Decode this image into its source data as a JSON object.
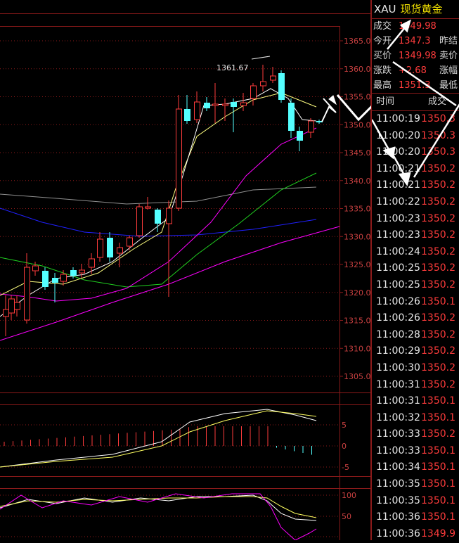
{
  "chart": {
    "price_axis": [
      "1365.0",
      "1360.0",
      "1355.0",
      "1350.0",
      "1345.0",
      "1340.0",
      "1335.0",
      "1330.0",
      "1325.0",
      "1320.0",
      "1315.0",
      "1310.0",
      "1305.0"
    ],
    "high_label": "1361.67",
    "macd_axis": [
      "5",
      "0",
      "-5"
    ],
    "kdj_axis": [
      "100",
      "50"
    ],
    "colors": {
      "up": "#ff3c3c",
      "down": "#54ffff",
      "grid": "#8b1a1a",
      "axis_text": "#c84040"
    }
  },
  "quote": {
    "symbol": "XAU",
    "name": "现货黄金",
    "rows": [
      {
        "label": "成交",
        "value": "1349.98",
        "extra": ""
      },
      {
        "label": "今开",
        "value": "1347.3",
        "extra": "昨结"
      },
      {
        "label": "买价",
        "value": "1349.98",
        "extra": "卖价"
      },
      {
        "label": "涨跌",
        "value": "+2.68",
        "extra": "涨幅"
      },
      {
        "label": "最高",
        "value": "1351.3",
        "extra": "最低"
      }
    ],
    "ticks_header": {
      "time": "时间",
      "price": "成交"
    },
    "ticks": [
      {
        "time": "11:00:19",
        "price": "1350.3"
      },
      {
        "time": "11:00:20",
        "price": "1350.3"
      },
      {
        "time": "11:00:20",
        "price": "1350.3"
      },
      {
        "time": "11:00:21",
        "price": "1350.2"
      },
      {
        "time": "11:00:21",
        "price": "1350.2"
      },
      {
        "time": "11:00:22",
        "price": "1350.2"
      },
      {
        "time": "11:00:23",
        "price": "1350.2"
      },
      {
        "time": "11:00:23",
        "price": "1350.2"
      },
      {
        "time": "11:00:24",
        "price": "1350.2"
      },
      {
        "time": "11:00:25",
        "price": "1350.2"
      },
      {
        "time": "11:00:25",
        "price": "1350.2"
      },
      {
        "time": "11:00:26",
        "price": "1350.1"
      },
      {
        "time": "11:00:26",
        "price": "1350.2"
      },
      {
        "time": "11:00:28",
        "price": "1350.2"
      },
      {
        "time": "11:00:29",
        "price": "1350.2"
      },
      {
        "time": "11:00:30",
        "price": "1350.2"
      },
      {
        "time": "11:00:31",
        "price": "1350.2"
      },
      {
        "time": "11:00:31",
        "price": "1350.1"
      },
      {
        "time": "11:00:32",
        "price": "1350.1"
      },
      {
        "time": "11:00:33",
        "price": "1350.2"
      },
      {
        "time": "11:00:33",
        "price": "1350.1"
      },
      {
        "time": "11:00:34",
        "price": "1350.1"
      },
      {
        "time": "11:00:35",
        "price": "1350.1"
      },
      {
        "time": "11:00:35",
        "price": "1350.1"
      },
      {
        "time": "11:00:36",
        "price": "1350.1"
      },
      {
        "time": "11:00:36",
        "price": "1349.9"
      }
    ]
  }
}
